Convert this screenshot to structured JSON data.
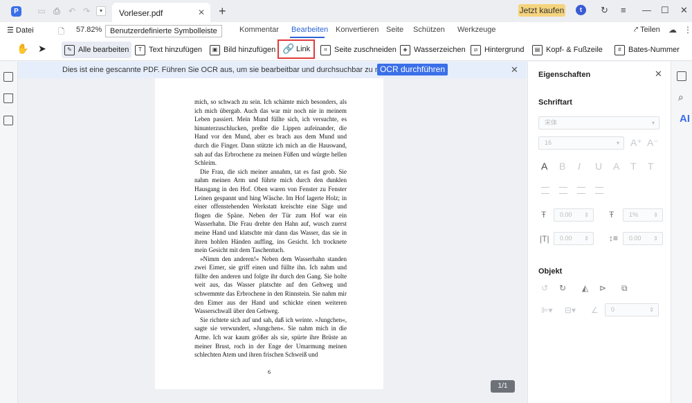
{
  "titlebar": {
    "logo": "P",
    "tab_title": "Vorleser.pdf",
    "buy_label": "Jetzt kaufen",
    "avatar_letter": "t"
  },
  "menubar": {
    "file_label": "Datei",
    "zoom": "57.82%",
    "tooltip": "Benutzerdefinierte Symbolleiste",
    "tabs": [
      "Seite",
      "Kommentar",
      "Bearbeiten",
      "Konvertieren",
      "Seite",
      "Schützen",
      "Werkzeuge"
    ],
    "first_tab_visible": "eite",
    "active_tab": "Bearbeiten",
    "share_label": "Teilen"
  },
  "toolbar": {
    "items": [
      {
        "label": "Alle bearbeiten",
        "icon": "edit-all-icon"
      },
      {
        "label": "Text hinzufügen",
        "icon": "add-text-icon"
      },
      {
        "label": "Bild hinzufügen",
        "icon": "add-image-icon"
      },
      {
        "label": "Link",
        "icon": "link-icon"
      },
      {
        "label": "Seite zuschneiden",
        "icon": "crop-icon"
      },
      {
        "label": "Wasserzeichen",
        "icon": "watermark-icon"
      },
      {
        "label": "Hintergrund",
        "icon": "background-icon"
      },
      {
        "label": "Kopf- & Fußzeile",
        "icon": "header-footer-icon"
      },
      {
        "label": "Bates-Nummer",
        "icon": "bates-icon"
      }
    ]
  },
  "notice": {
    "text": "Dies ist eine gescannte PDF. Führen Sie OCR aus, um sie bearbeitbar und durchsuchbar zu machen.",
    "button": "OCR durchführen"
  },
  "document": {
    "paragraphs": [
      "mich, so schwach zu sein. Ich schämte mich besonders, als ich mich übergab. Auch das war mir noch nie in meinem Leben passiert. Mein Mund füllte sich, ich versuchte, es hinunterzuschlucken, preßte die Lippen aufeinander, die Hand vor den Mund, aber es brach aus dem Mund und durch die Finger. Dann stützte ich mich an die Hauswand, sah auf das Erbrochene zu meinen Füßen und würgte hellen Schleim.",
      "Die Frau, die sich meiner annahm, tat es fast grob. Sie nahm meinen Arm und führte mich durch den dunklen Hausgang in den Hof. Oben waren von Fenster zu Fenster Leinen gespannt und hing Wäsche. Im Hof lagerte Holz; in einer offenstehenden Werkstatt kreischte eine Säge und flogen die Späne. Neben der Tür zum Hof war ein Wasserhahn. Die Frau drehte den Hahn auf, wusch zuerst meine Hand und klatschte mir dann das Wasser, das sie in ihren hohlen Händen auffing, ins Gesicht. Ich trocknete mein Gesicht mit dem Taschentuch.",
      "»Nimm den anderen!« Neben dem Wasserhahn standen zwei Eimer, sie griff einen und füllte ihn. Ich nahm und füllte den anderen und folgte ihr durch den Gang. Sie holte weit aus, das Wasser platschte auf den Gehweg und schwemmte das Erbrochene in den Rinnstein. Sie nahm mir den Eimer aus der Hand und schickte einen weiteren Wasserschwall über den Gehweg.",
      "Sie richtete sich auf und sah, daß ich weinte. »Jungchen«, sagte sie verwundert, »Jungchen«. Sie nahm mich in die Arme. Ich war kaum größer als sie, spürte ihre Brüste an meiner Brust, roch in der Enge der Umarmung meinen schlechten Atem und ihren frischen Schweiß und"
    ],
    "page_number": "6",
    "page_counter": "1/1"
  },
  "properties": {
    "title": "Eigenschaften",
    "font_section": "Schriftart",
    "font_name": "宋体",
    "font_size": "16",
    "char_spacing": "0.00",
    "line_spacing": "1%",
    "indent": "0.00",
    "para_spacing": "0.00",
    "object_section": "Objekt",
    "rotation": "0"
  },
  "far_rail": {
    "ai_label": "AI"
  }
}
